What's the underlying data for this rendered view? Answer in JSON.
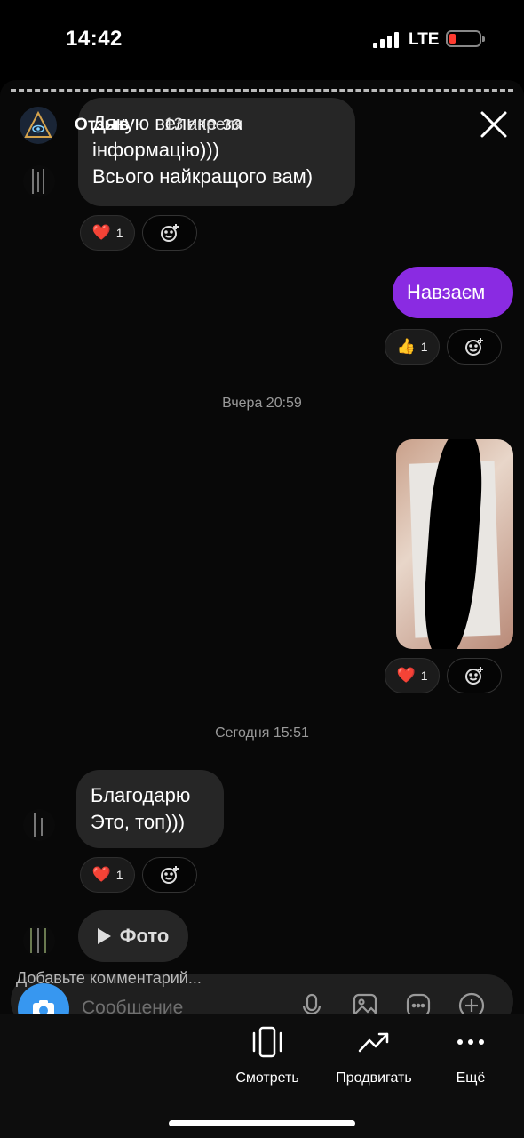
{
  "status_bar": {
    "time": "14:42",
    "network": "LTE"
  },
  "story": {
    "username": "Отзыв",
    "date": "13 апреля"
  },
  "chat": {
    "incoming_1": "Дякую велике за\nінформацію)))\nВсього найкращого вам)",
    "incoming_1_reaction": {
      "emoji": "❤️",
      "count": "1"
    },
    "outgoing_1": "Навзаєм",
    "outgoing_1_reaction": {
      "emoji": "👍",
      "count": "1"
    },
    "timestamp_1": "Вчера 20:59",
    "photo_reaction": {
      "emoji": "❤️",
      "count": "1"
    },
    "timestamp_2": "Сегодня 15:51",
    "incoming_2": "Благодарю\nЭто, топ)))",
    "incoming_2_reaction": {
      "emoji": "❤️",
      "count": "1"
    },
    "photo_chip_label": "Фото"
  },
  "composer": {
    "comment_hint": "Добавьте комментарий...",
    "placeholder": "Сообщение"
  },
  "bottom_actions": {
    "view": "Смотреть",
    "promote": "Продвигать",
    "more": "Ещё"
  },
  "colors": {
    "accent_purple": "#8a2be2",
    "camera_blue": "#3797f0",
    "battery_low": "#ff3b30"
  }
}
